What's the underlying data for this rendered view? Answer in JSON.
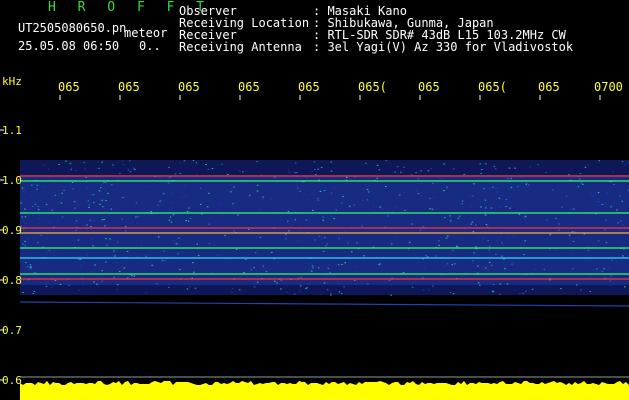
{
  "header": {
    "brand": "H R O F F T",
    "filename": "UT2505080650.pn",
    "mode": "meteor",
    "datetime": "25.05.08 06:50",
    "count": "0..",
    "info_labels": [
      "Observer",
      "Receiving Location",
      "Receiver",
      "Receiving Antenna"
    ],
    "info_values": [
      ": Masaki Kano",
      ": Shibukawa, Gunma, Japan",
      ": RTL-SDR SDR# 43dB L15 103.2MHz CW",
      ": 3el Yagi(V) Az 330 for Vladivostok"
    ]
  },
  "spectrogram": {
    "y_unit": "kHz",
    "y_ticks": [
      "1.1",
      "1.0",
      "0.9",
      "0.8",
      "0.7",
      "0.6"
    ],
    "x_ticks": [
      "065",
      "065",
      "065",
      "065",
      "065",
      "065(",
      "065",
      "065(",
      "065",
      "0700"
    ],
    "colors": {
      "background": "#000000",
      "axis_text": "#ffff33",
      "noise": "#1a2aa0",
      "signal": "#ff3030",
      "power": "#ffff00"
    }
  }
}
